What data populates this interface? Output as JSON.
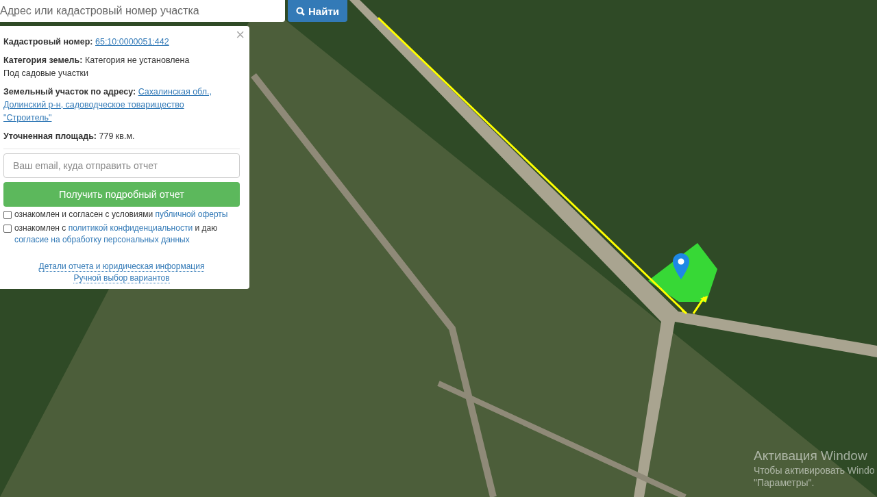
{
  "search": {
    "placeholder": "Адрес или кадастровый номер участка",
    "button": "Найти"
  },
  "info_panel": {
    "close": "×",
    "fields": [
      {
        "label": "Кадастровый номер:",
        "value": "65:10:0000051:442",
        "link": true
      },
      {
        "label": "Категория земель:",
        "value": "Категория не установлена",
        "link": false,
        "note": "Под садовые участки"
      },
      {
        "label": "Земельный участок по адресу:",
        "value": "Сахалинская обл.,",
        "more": [
          "Долинский р-н, садоводческое товарищество",
          "\"Строитель\""
        ],
        "link": true
      },
      {
        "label": "Уточненная площадь:",
        "value": "779 кв.м.",
        "link": false
      }
    ],
    "email": {
      "placeholder": "Ваш email, куда отправить отчет"
    },
    "submit": "Получить подробный отчет",
    "consents": [
      {
        "checked": false,
        "parts": [
          {
            "text": "ознакомлен и согласен с условиями",
            "link": false
          },
          {
            "text": "публичной оферты",
            "link": true
          }
        ]
      },
      {
        "checked": false,
        "parts": [
          {
            "text": "ознакомлен с",
            "link": false
          },
          {
            "text": "политикой конфиденциальности",
            "link": true
          },
          {
            "text": "и даю",
            "link": false
          },
          {
            "text": "согласие на обработку персональных данных",
            "link": true
          }
        ]
      }
    ],
    "links": [
      "Детали отчета и юридическая информация",
      "Ручной выбор вариантов"
    ]
  },
  "windows_notice": [
    "Активация Window",
    "Чтобы активировать Windo",
    "\"Параметры\"."
  ]
}
